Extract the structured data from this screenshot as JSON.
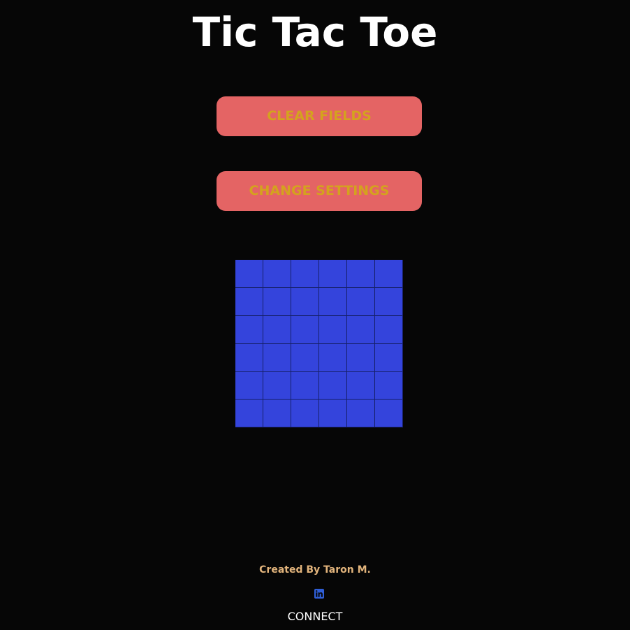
{
  "header": {
    "title": "Tic Tac Toe"
  },
  "controls": {
    "clear_label": "CLEAR FIELDS",
    "settings_label": "CHANGE SETTINGS"
  },
  "board": {
    "rows": 6,
    "columns": 6,
    "cells": [
      [
        "",
        "",
        "",
        "",
        "",
        ""
      ],
      [
        "",
        "",
        "",
        "",
        "",
        ""
      ],
      [
        "",
        "",
        "",
        "",
        "",
        ""
      ],
      [
        "",
        "",
        "",
        "",
        "",
        ""
      ],
      [
        "",
        "",
        "",
        "",
        "",
        ""
      ],
      [
        "",
        "",
        "",
        "",
        "",
        ""
      ]
    ]
  },
  "footer": {
    "credit": "Created By Taron M.",
    "social_icon": "linkedin-icon",
    "connect_label": "CONNECT"
  },
  "colors": {
    "background": "#060606",
    "button_bg": "#e46464",
    "button_text": "#d4a21e",
    "cell": "#3444dc",
    "credit_text": "#e2b47c",
    "linkedin": "#2f5ed6"
  }
}
